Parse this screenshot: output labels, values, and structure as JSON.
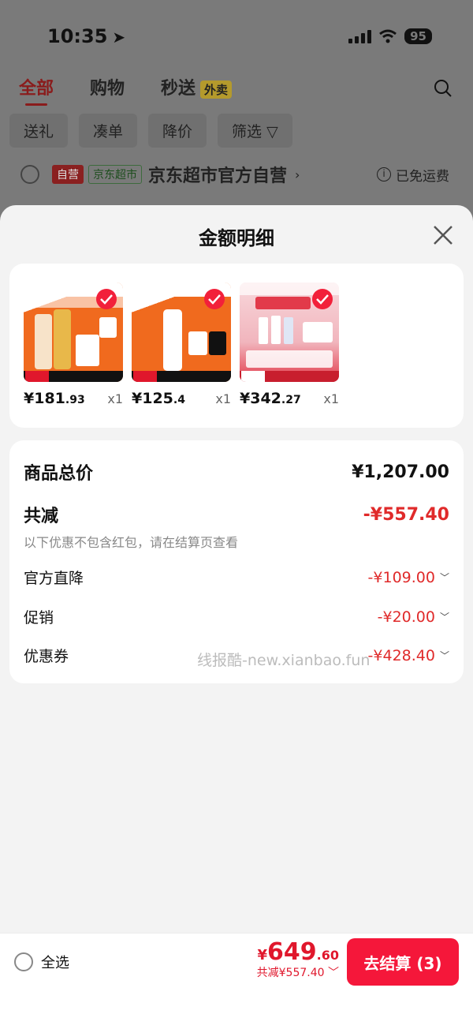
{
  "status_bar": {
    "time": "10:35",
    "battery": "95"
  },
  "top_tabs": [
    {
      "label": "全部"
    },
    {
      "label": "购物"
    },
    {
      "label": "秒送",
      "badge": "外卖"
    }
  ],
  "filters": [
    "送礼",
    "凑单",
    "降价",
    "筛选"
  ],
  "store": {
    "tag_self": "自营",
    "tag_market": "京东超市",
    "name": "京东超市官方自营",
    "shipping": "已免运费"
  },
  "sheet": {
    "title": "金额明细",
    "products": [
      {
        "price_int": "¥181",
        "price_dec": ".93",
        "qty": "x1",
        "colors": [
          "#f06a1e",
          "#ffffff"
        ]
      },
      {
        "price_int": "¥125",
        "price_dec": ".4",
        "qty": "x1",
        "colors": [
          "#f06a1e",
          "#ffffff"
        ]
      },
      {
        "price_int": "¥342",
        "price_dec": ".27",
        "qty": "x1",
        "colors": [
          "#f4c6cc",
          "#e23a4a"
        ]
      }
    ],
    "summary": {
      "total_label": "商品总价",
      "total_value": "¥1,207.00",
      "reduce_label": "共减",
      "reduce_value": "-¥557.40",
      "note": "以下优惠不包含红包，请在结算页查看",
      "items": [
        {
          "label": "官方直降",
          "value": "-¥109.00"
        },
        {
          "label": "促销",
          "value": "-¥20.00"
        },
        {
          "label": "优惠券",
          "value": "-¥428.40"
        }
      ],
      "watermark": "线报酷-new.xianbao.fun"
    }
  },
  "bottom": {
    "select_all": "全选",
    "yen": "¥",
    "price_int": "649",
    "price_dec": ".60",
    "saved": "共减¥557.40",
    "checkout": "去结算 (3)"
  }
}
